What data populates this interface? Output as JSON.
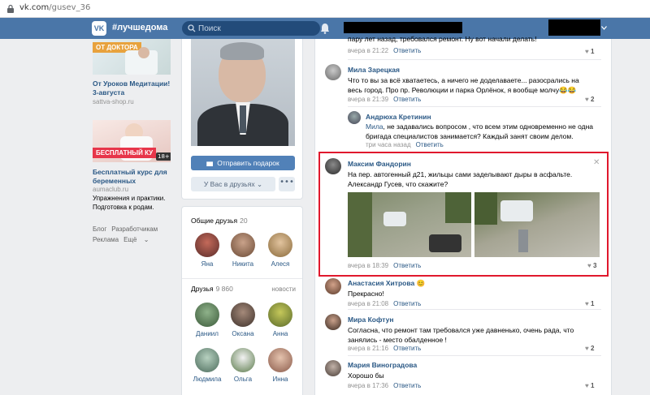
{
  "browser": {
    "url_host": "vk.com",
    "url_path": "/gusev_36"
  },
  "header": {
    "logo_text": "VK",
    "hashtag": "#лучшедома",
    "search_placeholder": "Поиск"
  },
  "ads": [
    {
      "image_band": "ОТ ДОКТОРА",
      "title": "От Уроков Медитации! 3-августа",
      "domain": "sattva-shop.ru"
    },
    {
      "image_band": "БЕСПЛАТНЫЙ КУ",
      "image_badge": "18+",
      "title": "Бесплатный курс для беременных",
      "domain": "aumaclub.ru",
      "desc": "Упражнения и практики. Подготовка к родам."
    }
  ],
  "footer": {
    "links": [
      "Блог",
      "Разработчикам",
      "Реклама",
      "Ещё"
    ]
  },
  "profile": {
    "gift_button": "Отправить подарок",
    "friends_button": "У Вас в друзьях",
    "more_button": "•••"
  },
  "common_friends": {
    "title": "Общие друзья",
    "count": "20",
    "items": [
      "Яна",
      "Никита",
      "Алеся"
    ]
  },
  "friends": {
    "title": "Друзья",
    "count": "9 860",
    "link": "новости",
    "items": [
      "Даниил",
      "Оксана",
      "Анна",
      "Людмила",
      "Ольга",
      "Инна"
    ]
  },
  "feed": {
    "top_comment": {
      "text": "пару лет назад, требовался ремонт. Ну вот начали делать!",
      "time": "вчера в 21:22",
      "reply": "Ответить",
      "likes": "1"
    },
    "comments": [
      {
        "author": "Мила Зарецкая",
        "text": "Что то вы за всё хватаетесь, а ничего не доделаваете... разосрались на весь город. Про пр. Революции и парка Орлёнок, я вообще молчу😂😂",
        "time": "вчера в 21:39",
        "reply": "Ответить",
        "likes": "2"
      },
      {
        "author": "Андрюха Кретинин",
        "mention": "Мила",
        "text": ", не задавались вопросом , что всем этим одновременно не одна бригада специалистов занимается? Каждый занят своим делом.",
        "time": "три часа назад",
        "reply": "Ответить"
      },
      {
        "author": "Максим Фандорин",
        "text": "На пер. автогенный д21, жильцы сами заделывают дыры в асфальте. Александр Гусев, что скажите?",
        "time": "вчера в 18:39",
        "reply": "Ответить",
        "likes": "3",
        "close": "✕"
      },
      {
        "author": "Анастасия Хитрова 😊",
        "text": "Прекрасно!",
        "time": "вчера в 21:08",
        "reply": "Ответить",
        "likes": "1"
      },
      {
        "author": "Мира Кофтун",
        "text": "Согласна, что ремонт там требовался уже давненько, очень рада, что занялись - место обалденное !",
        "time": "вчера в 21:16",
        "reply": "Ответить",
        "likes": "2"
      },
      {
        "author": "Мария Виноградова",
        "text": "Хорошо бы",
        "time": "вчера в 17:36",
        "reply": "Ответить",
        "likes": "1"
      }
    ]
  },
  "colors": {
    "header": "#4a76a8",
    "link": "#2a5885",
    "highlight": "#e0182d",
    "button": "#5181b8"
  }
}
